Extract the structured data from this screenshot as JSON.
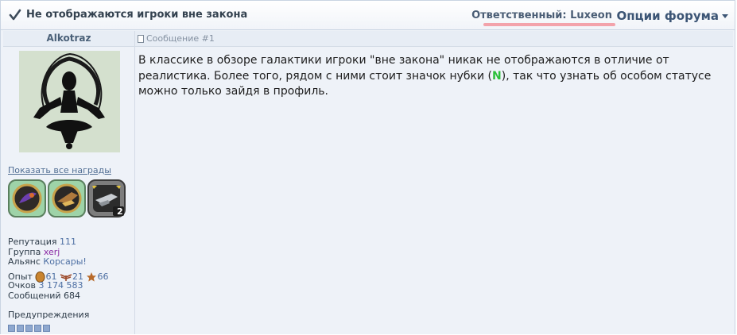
{
  "header": {
    "title": "Не отображаются игроки вне закона",
    "responsible": "Ответственный: Luxeon",
    "forum_options": "Опции форума"
  },
  "post": {
    "number_label": "Сообщение #1",
    "body_before": "В классике в обзоре галактики игроки \"вне закона\" никак не отображаются в отличие от реалистика. Более того, рядом с ними стоит значок нубки (",
    "body_badge": "N",
    "body_after": "), так что узнать об особом статусе можно только зайдя в профиль."
  },
  "author": {
    "username": "Alkotraz",
    "show_awards": "Показать все награды",
    "medal_badge": "2",
    "reputation_label": "Репутация",
    "reputation_value": "111",
    "group_label": "Группа",
    "group_value": "xerj",
    "alliance_label": "Альянс",
    "alliance_value": "Корсары!",
    "exp_label": "Опыт",
    "exp_1": "61",
    "exp_2": "21",
    "exp_3": "66",
    "points_label": "Очков",
    "points_value": "3 174 583",
    "messages_label": "Сообщений",
    "messages_value": "684",
    "warnings_label": "Предупреждения"
  },
  "colors": {
    "accent": "#3c5575",
    "badge_green": "#2bbf3a",
    "group_purple": "#8a2aa4"
  }
}
